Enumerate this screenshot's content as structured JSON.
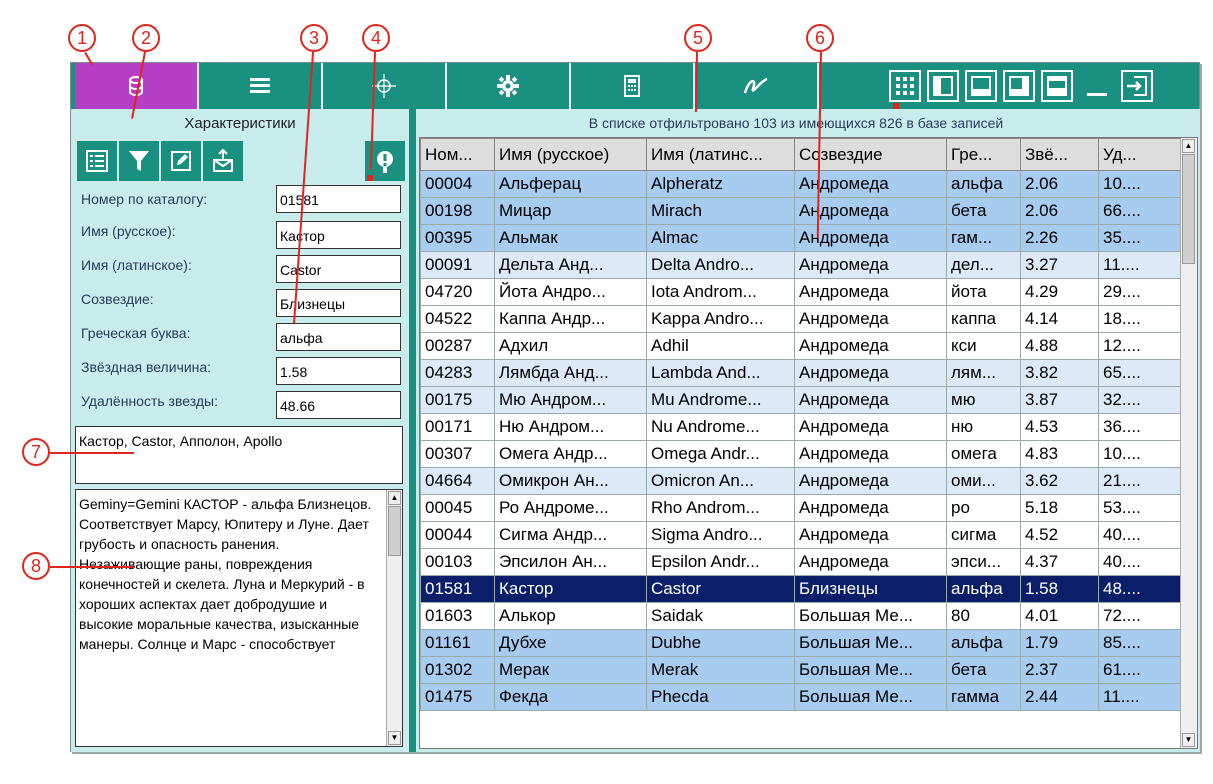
{
  "callouts": [
    "1",
    "2",
    "3",
    "4",
    "5",
    "6",
    "7",
    "8"
  ],
  "toolbar": {
    "items": [
      "database-icon",
      "list-icon",
      "crosshair-icon",
      "gear-icon",
      "calculator-icon",
      "signature-icon"
    ],
    "window_buttons": [
      "grid-icon",
      "layout-left-icon",
      "layout-bottom-icon",
      "layout-right-icon",
      "layout-top-icon",
      "minimize-icon",
      "exit-icon"
    ]
  },
  "left": {
    "title": "Характеристики",
    "buttons": [
      "list-view-icon",
      "filter-icon",
      "edit-icon",
      "export-icon"
    ],
    "info_button": "info-icon",
    "fields": [
      {
        "label": "Номер по каталогу:",
        "value": "01581"
      },
      {
        "label": "Имя (русское):",
        "value": "Кастор"
      },
      {
        "label": "Имя (латинское):",
        "value": "Castor"
      },
      {
        "label": "Созвездие:",
        "value": "Близнецы"
      },
      {
        "label": "Греческая буква:",
        "value": "альфа"
      },
      {
        "label": "Звёздная величина:",
        "value": "1.58"
      },
      {
        "label": "Удалённость звезды:",
        "value": "48.66"
      }
    ],
    "names": "Кастор, Castor, Апполон, Apollo",
    "description": "Geminy=Gemini КАСТОР - альфа Близнецов. Соответствует Марсу, Юпитеру и Луне. Дает грубость и опасность ранения. Незаживающие раны, повреждения конечностей и скелета. Луна и Меркурий - в хороших аспектах дает добродушие и высокие моральные качества, изысканные манеры. Солнце и Марс - способствует"
  },
  "status": "В списке отфильтровано 103 из имеющихся 826 в базе записей",
  "table": {
    "headers": [
      "Ном...",
      "Имя (русское)",
      "Имя (латинс...",
      "Созвездие",
      "Гре...",
      "Звё...",
      "Уд..."
    ],
    "rows": [
      {
        "style": "blue",
        "cells": [
          "00004",
          "Альферац",
          "Alpheratz",
          "Андромеда",
          "альфа",
          "2.06",
          "10...."
        ]
      },
      {
        "style": "blue",
        "cells": [
          "00198",
          "Мицар",
          "Mirach",
          "Андромеда",
          "бета",
          "2.06",
          "66...."
        ]
      },
      {
        "style": "blue",
        "cells": [
          "00395",
          "Альмак",
          "Almac",
          "Андромеда",
          "гам...",
          "2.26",
          "35...."
        ]
      },
      {
        "style": "light",
        "cells": [
          "00091",
          "Дельта Анд...",
          "Delta Andro...",
          "Андромеда",
          "дел...",
          "3.27",
          "11...."
        ]
      },
      {
        "style": "white",
        "cells": [
          "04720",
          "Йота Андро...",
          "Iota Androm...",
          "Андромеда",
          "йота",
          "4.29",
          "29...."
        ]
      },
      {
        "style": "white",
        "cells": [
          "04522",
          "Каппа Андр...",
          "Kappa Andro...",
          "Андромеда",
          "каппа",
          "4.14",
          "18...."
        ]
      },
      {
        "style": "white",
        "cells": [
          "00287",
          "Адхил",
          "Adhil",
          "Андромеда",
          "кси",
          "4.88",
          "12...."
        ]
      },
      {
        "style": "light",
        "cells": [
          "04283",
          "Лямбда Анд...",
          "Lambda And...",
          "Андромеда",
          "лям...",
          "3.82",
          "65...."
        ]
      },
      {
        "style": "light",
        "cells": [
          "00175",
          "Мю Андром...",
          "Mu Androme...",
          "Андромеда",
          "мю",
          "3.87",
          "32...."
        ]
      },
      {
        "style": "white",
        "cells": [
          "00171",
          "Ню Андром...",
          "Nu Androme...",
          "Андромеда",
          "ню",
          "4.53",
          "36...."
        ]
      },
      {
        "style": "white",
        "cells": [
          "00307",
          "Омега Андр...",
          "Omega Andr...",
          "Андромеда",
          "омега",
          "4.83",
          "10...."
        ]
      },
      {
        "style": "light",
        "cells": [
          "04664",
          "Омикрон Ан...",
          "Omicron An...",
          "Андромеда",
          "оми...",
          "3.62",
          "21...."
        ]
      },
      {
        "style": "white",
        "cells": [
          "00045",
          "Ро Андроме...",
          "Rho Androm...",
          "Андромеда",
          "ро",
          "5.18",
          "53...."
        ]
      },
      {
        "style": "white",
        "cells": [
          "00044",
          "Сигма Андр...",
          "Sigma Andro...",
          "Андромеда",
          "сигма",
          "4.52",
          "40...."
        ]
      },
      {
        "style": "white",
        "cells": [
          "00103",
          "Эпсилон Ан...",
          "Epsilon Andr...",
          "Андромеда",
          "эпси...",
          "4.37",
          "40...."
        ]
      },
      {
        "style": "sel",
        "cells": [
          "01581",
          "Кастор",
          "Castor",
          "Близнецы",
          "альфа",
          "1.58",
          "48...."
        ]
      },
      {
        "style": "white",
        "cells": [
          "01603",
          "Алькор",
          "Saidak",
          "Большая Ме...",
          "80",
          "4.01",
          "72...."
        ]
      },
      {
        "style": "blue",
        "cells": [
          "01161",
          "Дубхе",
          "Dubhe",
          "Большая Ме...",
          "альфа",
          "1.79",
          "85...."
        ]
      },
      {
        "style": "blue",
        "cells": [
          "01302",
          "Мерак",
          "Merak",
          "Большая Ме...",
          "бета",
          "2.37",
          "61...."
        ]
      },
      {
        "style": "blue",
        "cells": [
          "01475",
          "Фекда",
          "Phecda",
          "Большая Ме...",
          "гамма",
          "2.44",
          "11...."
        ]
      }
    ]
  },
  "colors": {
    "toolbar": "#1a9080",
    "active": "#b43fc4",
    "panel": "#c8ecec",
    "selected": "#0a1e6a",
    "callout": "#e0261a"
  }
}
